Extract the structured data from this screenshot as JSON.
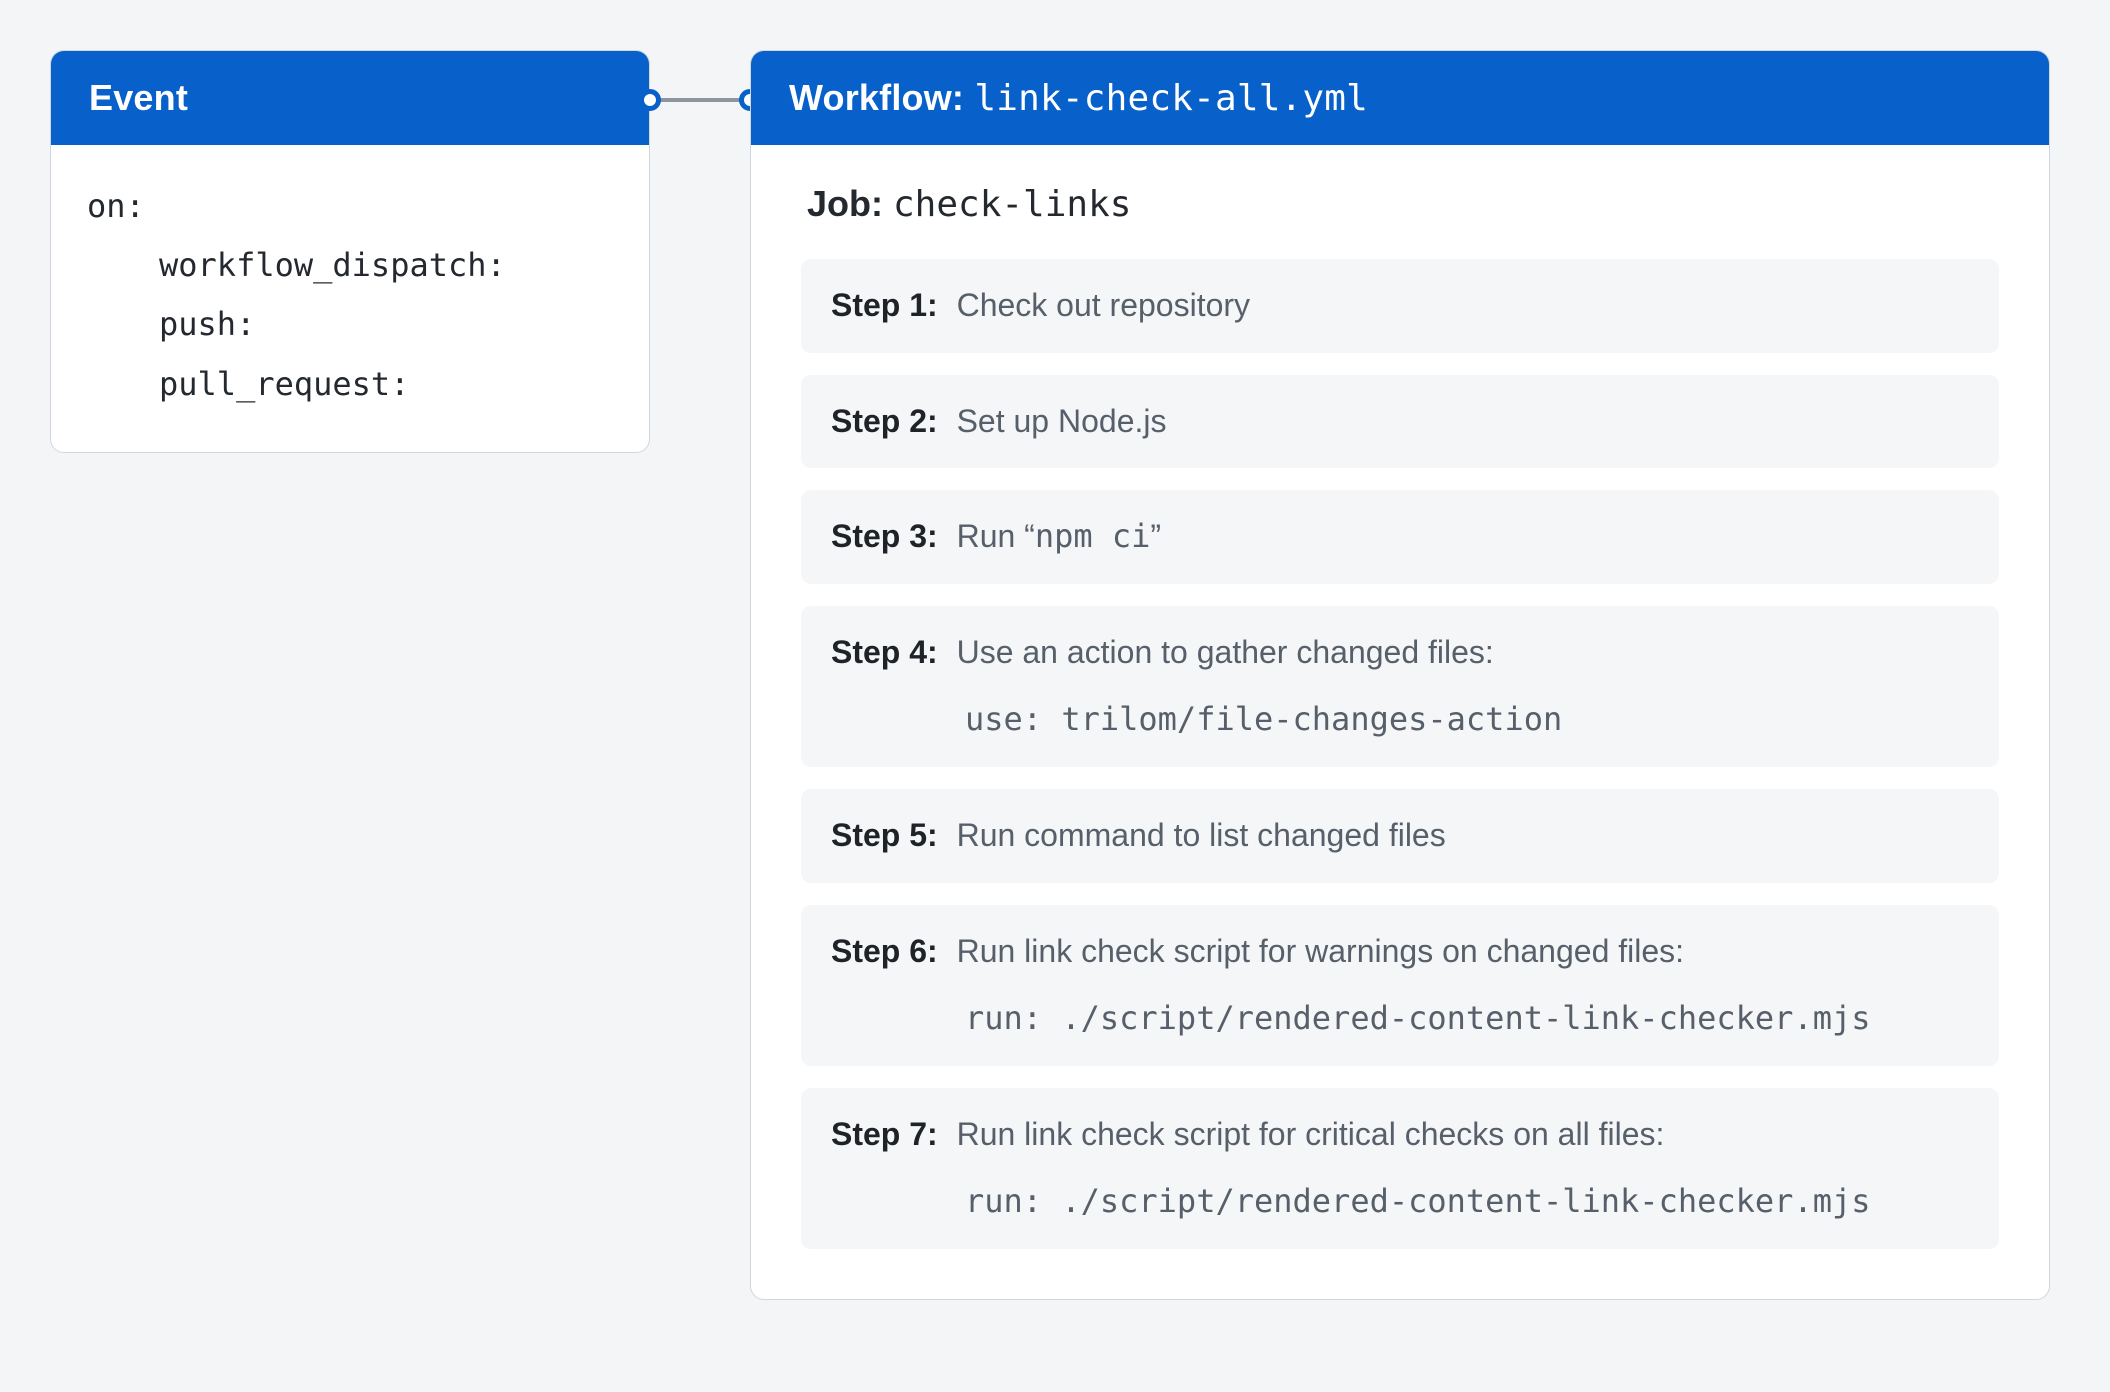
{
  "event": {
    "title": "Event",
    "on_key": "on:",
    "triggers": [
      "workflow_dispatch:",
      "push:",
      "pull_request:"
    ]
  },
  "workflow": {
    "title_label": "Workflow: ",
    "title_value": "link-check-all.yml",
    "job_label": "Job: ",
    "job_value": "check-links",
    "steps": [
      {
        "label": "Step 1:",
        "text": "Check out repository"
      },
      {
        "label": "Step 2:",
        "text": "Set up Node.js"
      },
      {
        "label": "Step 3:",
        "text_prefix": "Run “",
        "code": "npm ci",
        "text_suffix": "”"
      },
      {
        "label": "Step 4:",
        "text": "Use an action to gather changed files:",
        "sub": "use: trilom/file-changes-action"
      },
      {
        "label": "Step 5:",
        "text": "Run command to list changed files"
      },
      {
        "label": "Step 6:",
        "text": "Run link check script for warnings on changed files:",
        "sub": "run: ./script/rendered-content-link-checker.mjs"
      },
      {
        "label": "Step 7:",
        "text": "Run link check script for critical checks on all files:",
        "sub": "run: ./script/rendered-content-link-checker.mjs"
      }
    ]
  }
}
